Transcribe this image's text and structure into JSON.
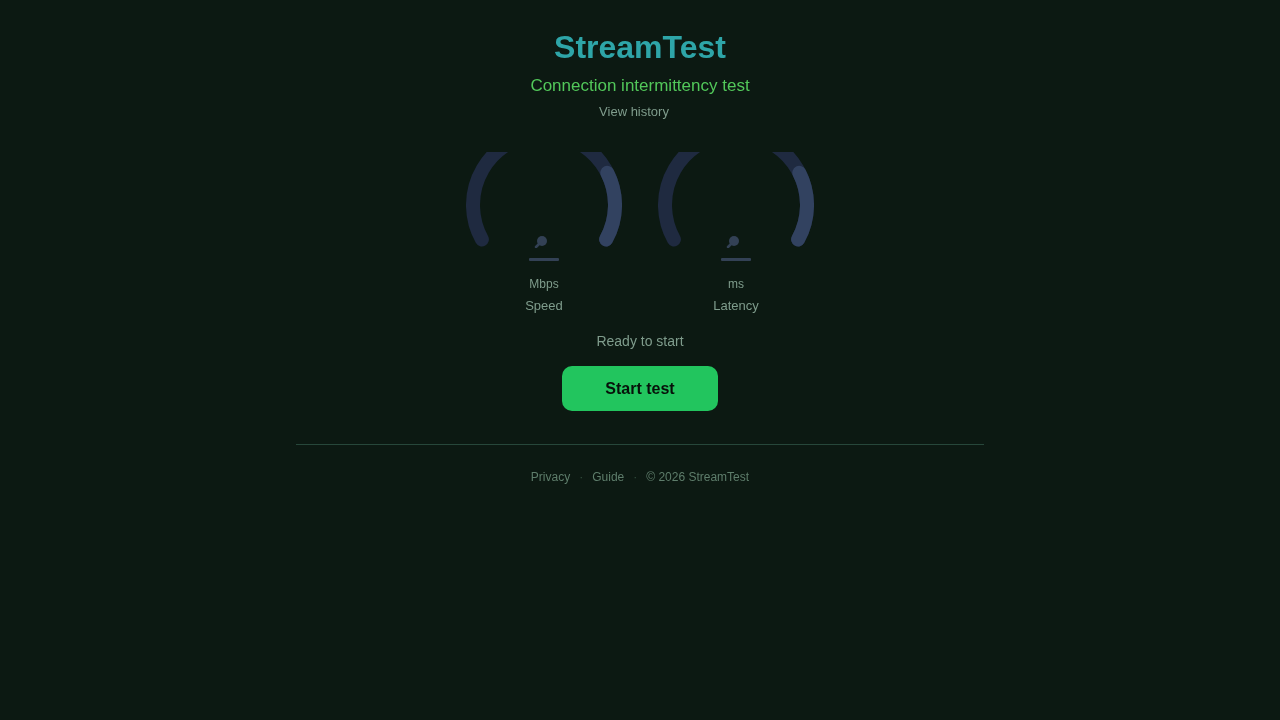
{
  "header": {
    "title": "StreamTest",
    "subtitle": "Connection intermittency test",
    "history_link": "View history"
  },
  "gauges": [
    {
      "unit": "Mbps",
      "label": "Speed"
    },
    {
      "unit": "ms",
      "label": "Latency"
    }
  ],
  "status": "Ready to start",
  "start_button": {
    "label": "Start test"
  },
  "footer": {
    "items": [
      {
        "kind": "link",
        "text": "Privacy"
      },
      {
        "kind": "separator",
        "text": "·"
      },
      {
        "kind": "link",
        "text": "Guide"
      },
      {
        "kind": "separator",
        "text": "·"
      },
      {
        "kind": "text",
        "text": "© 2026 StreamTest"
      }
    ]
  }
}
